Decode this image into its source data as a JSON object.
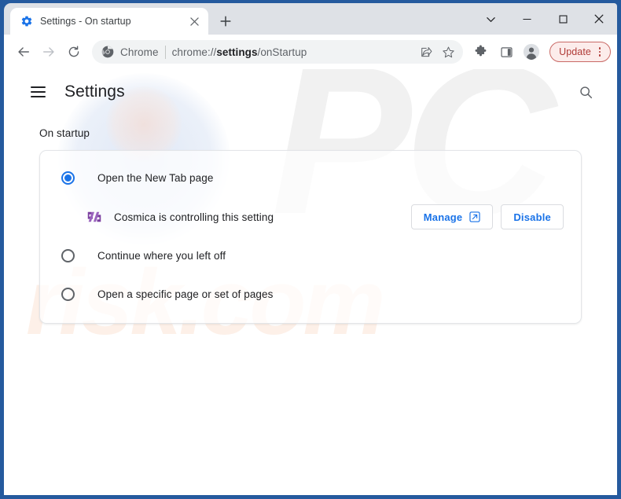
{
  "window": {
    "controls": [
      {
        "name": "tab-search-chevron",
        "glyph": "chevron-down-icon"
      },
      {
        "name": "minimize",
        "glyph": "minimize-icon"
      },
      {
        "name": "maximize",
        "glyph": "maximize-icon"
      },
      {
        "name": "close",
        "glyph": "close-icon"
      }
    ]
  },
  "tab": {
    "title": "Settings - On startup",
    "favicon": "gear-icon",
    "close_label": "×",
    "new_tab_label": "+"
  },
  "toolbar": {
    "back": "back-arrow-icon",
    "forward": "forward-arrow-icon",
    "reload": "reload-icon",
    "omnibox": {
      "app_name": "Chrome",
      "url_scheme": "chrome://",
      "url_bold": "settings",
      "url_tail": "/onStartup",
      "full_url": "chrome://settings/onStartup",
      "share_icon": "share-icon",
      "bookmark_icon": "star-icon"
    },
    "extensions_icon": "puzzle-piece-icon",
    "side_panel_icon": "side-panel-icon",
    "profile_icon": "profile-avatar-icon",
    "update_label": "Update",
    "menu_icon": "three-dot-menu-icon",
    "update_border_color": "#c96a66",
    "update_bg_color": "#fceceb",
    "update_text_color": "#b03a36"
  },
  "settings": {
    "menu_label": "Main menu",
    "title": "Settings",
    "search_label": "Search settings",
    "section_label": "On startup",
    "options": [
      {
        "label": "Open the New Tab page",
        "checked": true
      },
      {
        "label": "Continue where you left off",
        "checked": false
      },
      {
        "label": "Open a specific page or set of pages",
        "checked": false
      }
    ],
    "controlled": {
      "icon": "cosmica-extension-icon",
      "text": "Cosmica is controlling this setting",
      "manage_label": "Manage",
      "manage_icon": "external-link-icon",
      "disable_label": "Disable"
    },
    "accent_color": "#1a73e8"
  },
  "watermark": {
    "primary": "PC",
    "secondary": "risk.com"
  }
}
